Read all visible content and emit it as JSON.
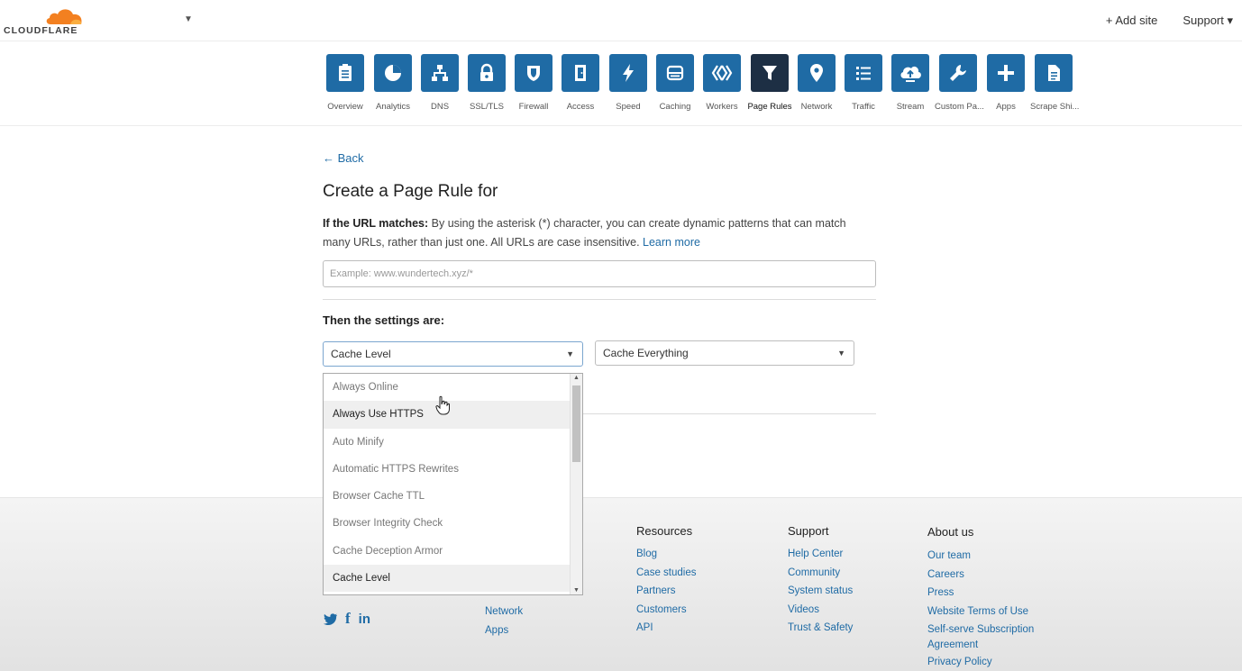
{
  "header": {
    "logo_text": "CLOUDFLARE",
    "add_site": "+ Add site",
    "support": "Support ▾"
  },
  "nav": [
    {
      "label": "Overview",
      "icon": "clipboard-icon"
    },
    {
      "label": "Analytics",
      "icon": "pie-chart-icon"
    },
    {
      "label": "DNS",
      "icon": "network-icon"
    },
    {
      "label": "SSL/TLS",
      "icon": "lock-icon"
    },
    {
      "label": "Firewall",
      "icon": "shield-icon"
    },
    {
      "label": "Access",
      "icon": "door-icon"
    },
    {
      "label": "Speed",
      "icon": "lightning-icon"
    },
    {
      "label": "Caching",
      "icon": "server-icon"
    },
    {
      "label": "Workers",
      "icon": "workers-icon"
    },
    {
      "label": "Page Rules",
      "icon": "filter-icon",
      "active": true
    },
    {
      "label": "Network",
      "icon": "location-pin-icon"
    },
    {
      "label": "Traffic",
      "icon": "list-icon"
    },
    {
      "label": "Stream",
      "icon": "cloud-upload-icon"
    },
    {
      "label": "Custom Pa...",
      "icon": "wrench-icon"
    },
    {
      "label": "Apps",
      "icon": "plus-icon"
    },
    {
      "label": "Scrape Shi...",
      "icon": "document-icon"
    }
  ],
  "main": {
    "back": "← Back",
    "title": "Create a Page Rule for",
    "url_label": "If the URL matches:",
    "url_desc": " By using the asterisk (*) character, you can create dynamic patterns that can match many URLs, rather than just one. All URLs are case insensitive. ",
    "learn_more": "Learn more",
    "url_placeholder": "Example: www.wundertech.xyz/*",
    "settings_label": "Then the settings are:",
    "setting_select": "Cache Level",
    "value_select": "Cache Everything"
  },
  "dropdown": {
    "options": [
      "Always Online",
      "Always Use HTTPS",
      "Auto Minify",
      "Automatic HTTPS Rewrites",
      "Browser Cache TTL",
      "Browser Integrity Check",
      "Cache Deception Armor",
      "Cache Level"
    ],
    "hovered": "Always Use HTTPS",
    "selected": "Cache Level"
  },
  "footer": {
    "social": [
      "twitter-icon",
      "facebook-icon",
      "linkedin-icon"
    ],
    "products_partial": [
      "Network",
      "Apps"
    ],
    "resources": {
      "title": "Resources",
      "links": [
        "Blog",
        "Case studies",
        "Partners",
        "Customers",
        "API"
      ]
    },
    "support": {
      "title": "Support",
      "links": [
        "Help Center",
        "Community",
        "System status",
        "Videos",
        "Trust & Safety"
      ]
    },
    "about": {
      "title": "About us",
      "links": [
        "Our team",
        "Careers",
        "Press",
        "Website Terms of Use",
        "Self-serve Subscription",
        "Agreement",
        "Privacy Policy"
      ]
    }
  },
  "colors": {
    "accent": "#1f6ba5",
    "active_tile": "#1d2f44",
    "logo": "#f38020"
  }
}
